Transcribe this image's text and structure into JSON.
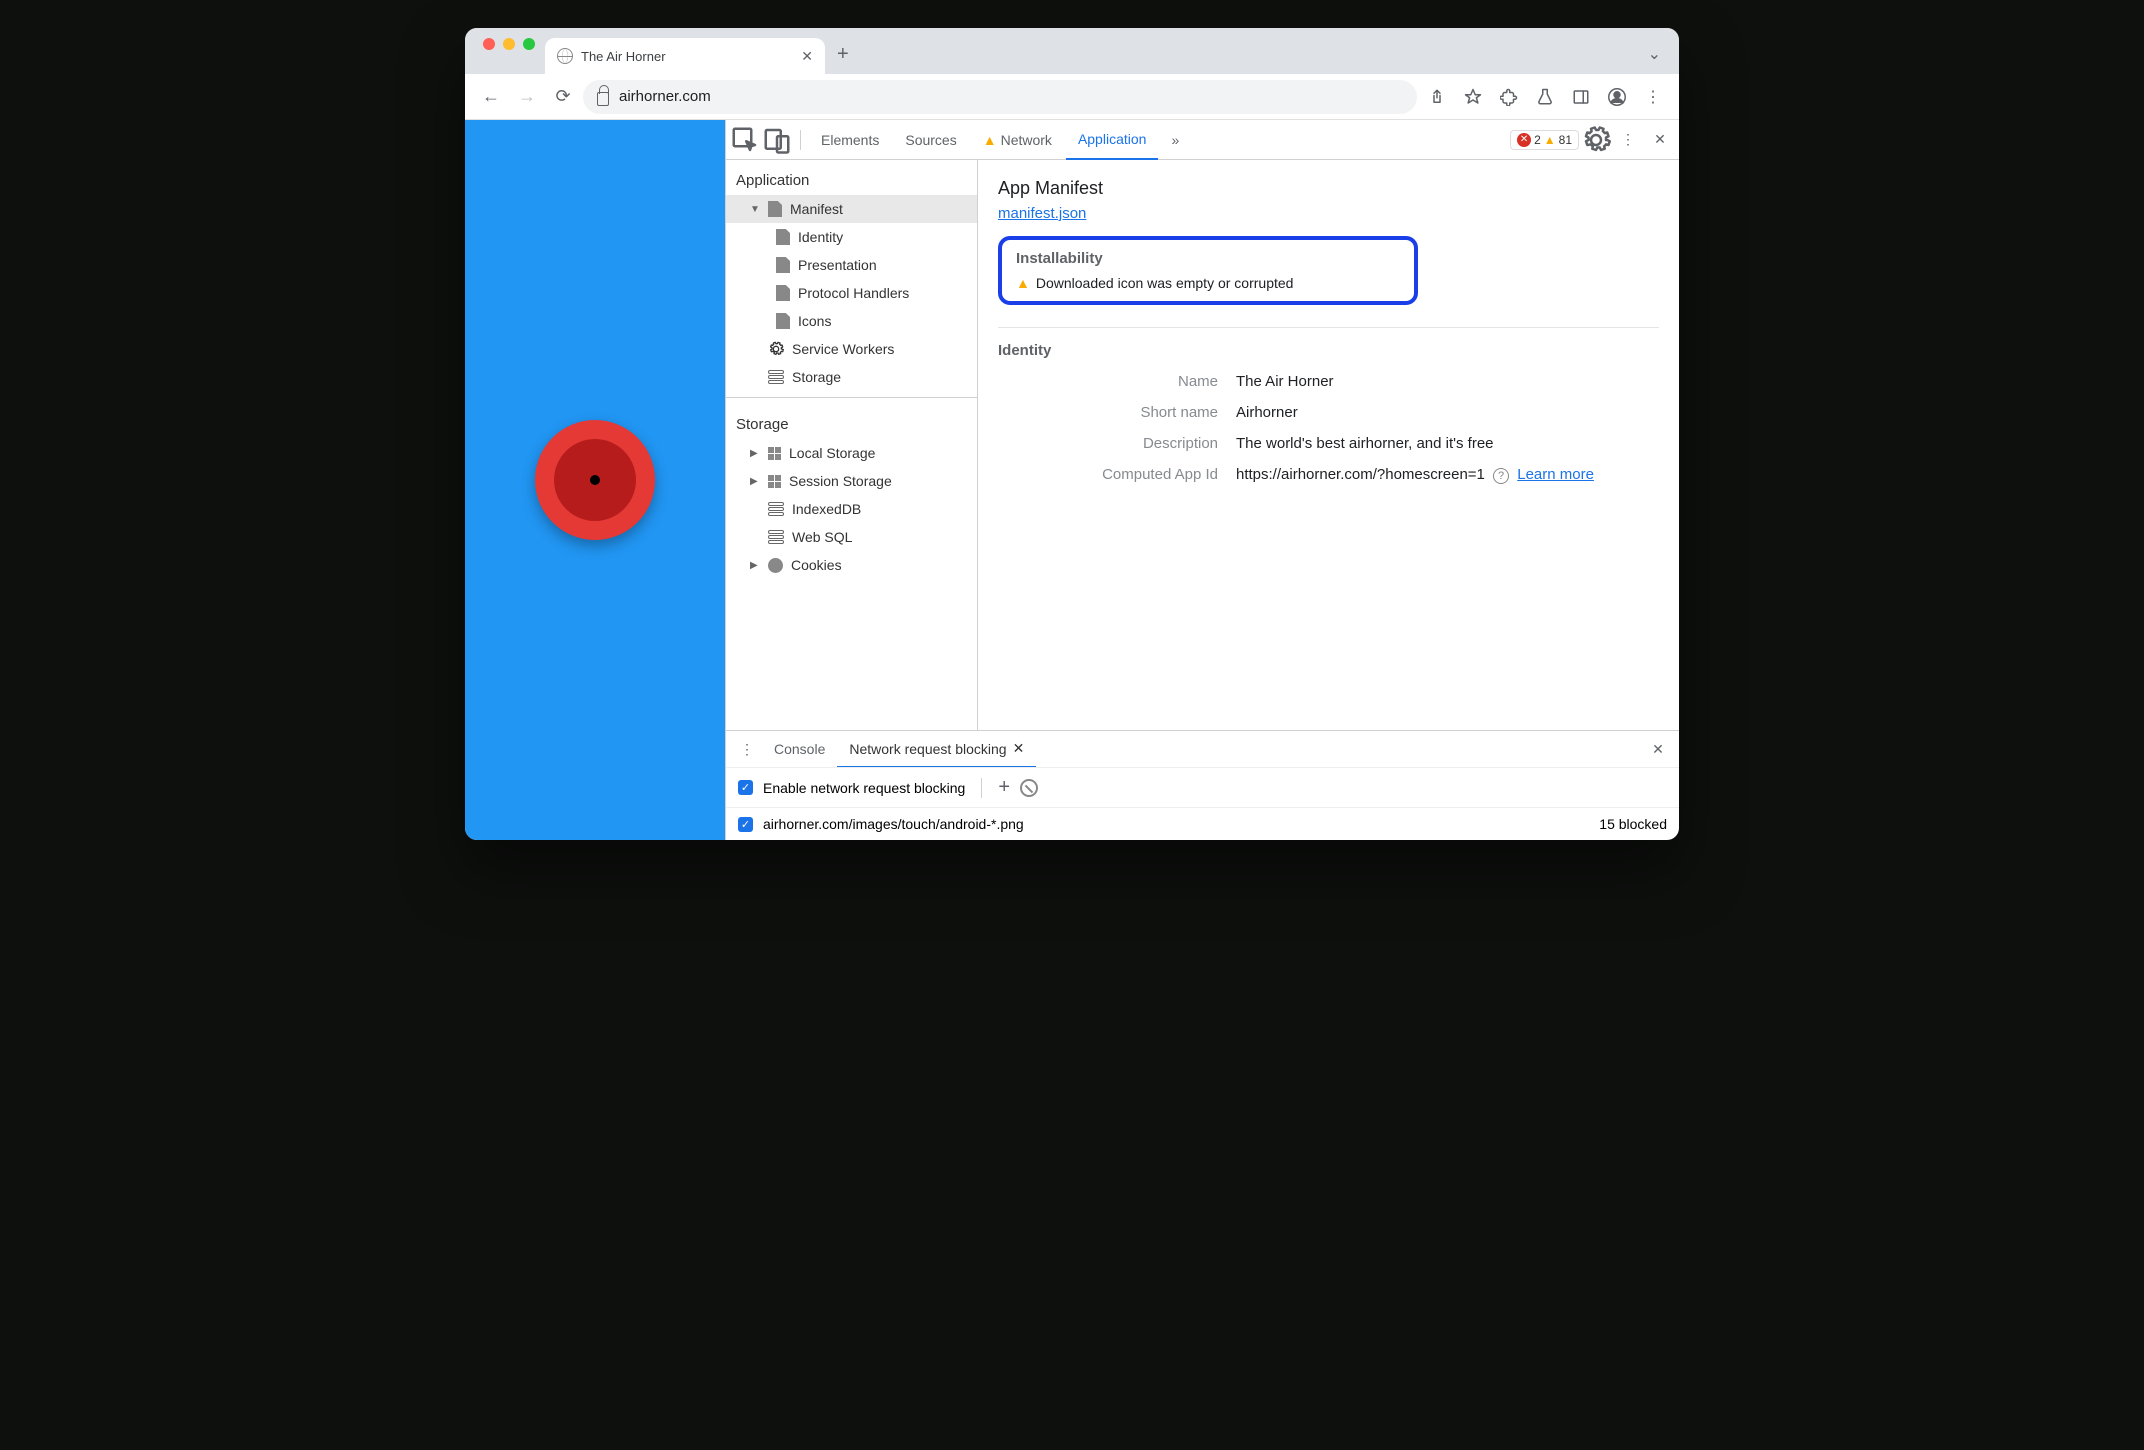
{
  "browser": {
    "tab_title": "The Air Horner",
    "url_display": "airhorner.com"
  },
  "devtools": {
    "tabs": [
      "Elements",
      "Sources",
      "Network",
      "Application"
    ],
    "active_tab": "Application",
    "errors": 2,
    "warnings": 81
  },
  "sidebar": {
    "section_app": "Application",
    "app_items": {
      "manifest": "Manifest",
      "identity": "Identity",
      "presentation": "Presentation",
      "protocol": "Protocol Handlers",
      "icons": "Icons",
      "sw": "Service Workers",
      "storage": "Storage"
    },
    "section_storage": "Storage",
    "storage_items": {
      "local": "Local Storage",
      "session": "Session Storage",
      "idb": "IndexedDB",
      "websql": "Web SQL",
      "cookies": "Cookies"
    }
  },
  "content": {
    "title": "App Manifest",
    "manifest_link": "manifest.json",
    "installability_h": "Installability",
    "installability_msg": "Downloaded icon was empty or corrupted",
    "identity_h": "Identity",
    "identity": {
      "name_k": "Name",
      "name_v": "The Air Horner",
      "short_k": "Short name",
      "short_v": "Airhorner",
      "desc_k": "Description",
      "desc_v": "The world's best airhorner, and it's free",
      "appid_k": "Computed App Id",
      "appid_v": "https://airhorner.com/?homescreen=1",
      "learn": "Learn more"
    }
  },
  "drawer": {
    "tabs": {
      "console": "Console",
      "nrb": "Network request blocking"
    },
    "enable_label": "Enable network request blocking",
    "pattern": "airhorner.com/images/touch/android-*.png",
    "blocked": "15 blocked"
  }
}
